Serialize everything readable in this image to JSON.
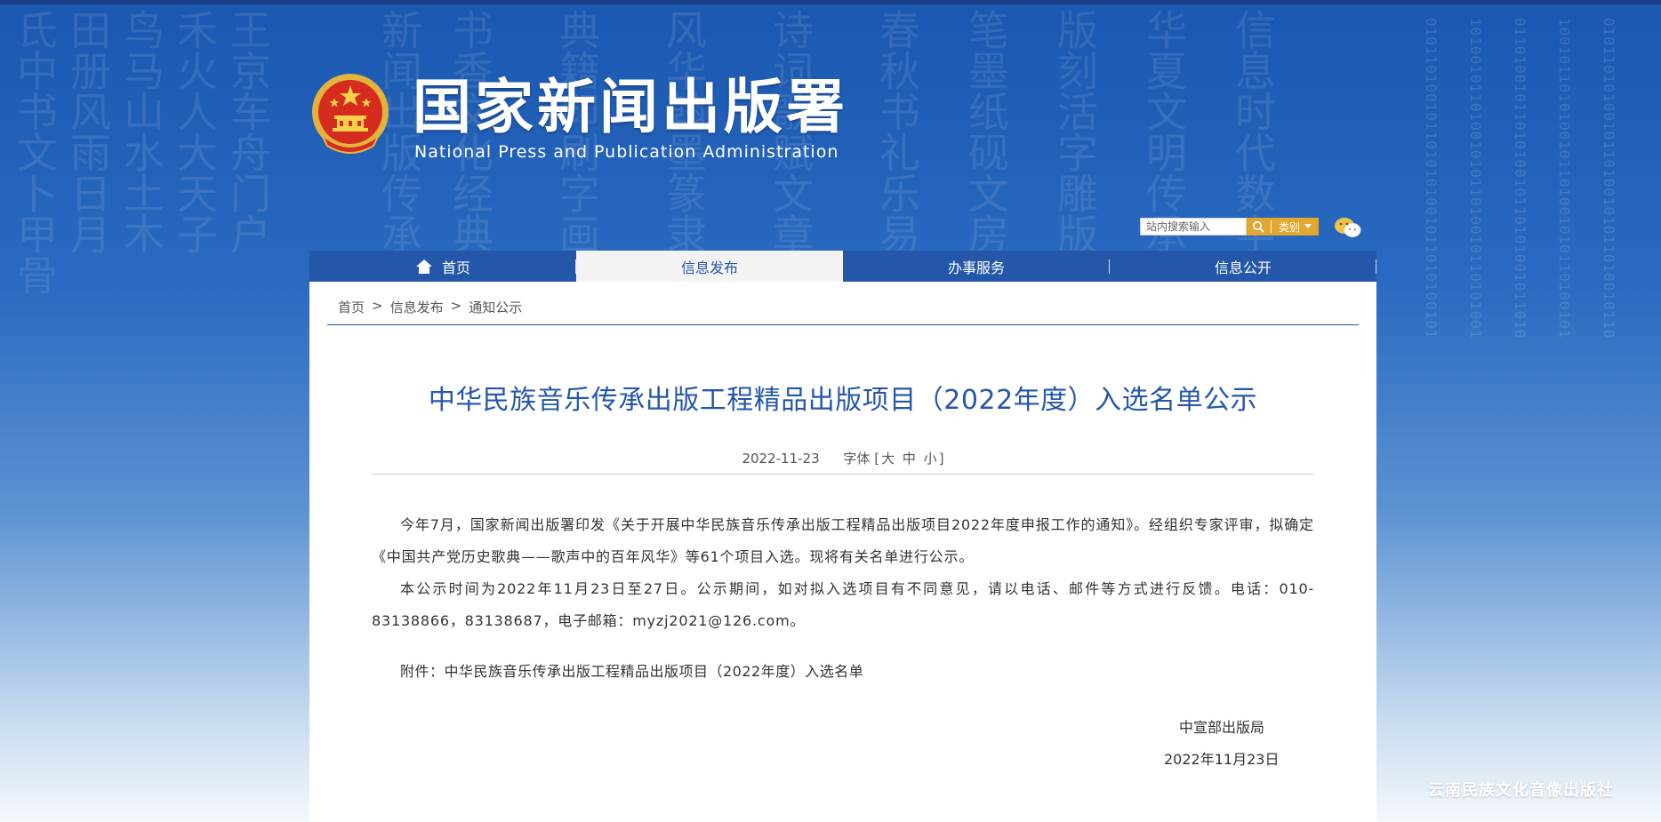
{
  "header": {
    "title_cn": "国家新闻出版署",
    "title_en": "National  Press and Publication Administration"
  },
  "search": {
    "placeholder": "站内搜索输入",
    "category_label": "类别"
  },
  "nav": {
    "items": [
      {
        "label": "首页"
      },
      {
        "label": "信息发布"
      },
      {
        "label": "办事服务"
      },
      {
        "label": "信息公开"
      }
    ]
  },
  "breadcrumb": {
    "home": "首页",
    "section": "信息发布",
    "current": "通知公示",
    "separator": ">"
  },
  "article": {
    "title": "中华民族音乐传承出版工程精品出版项目（2022年度）入选名单公示",
    "date": "2022-11-23",
    "font_size_label": "字体",
    "font_open": "[",
    "font_large": "大",
    "font_medium": "中",
    "font_small": "小",
    "font_close": "]",
    "paragraphs": [
      "今年7月，国家新闻出版署印发《关于开展中华民族音乐传承出版工程精品出版项目2022年度申报工作的通知》。经组织专家评审，拟确定《中国共产党历史歌典——歌声中的百年风华》等61个项目入选。现将有关名单进行公示。",
      "本公示时间为2022年11月23日至27日。公示期间，如对拟入选项目有不同意见，请以电话、邮件等方式进行反馈。电话：010-83138866，83138687，电子邮箱：myzj2021@126.com。"
    ],
    "attachment": "附件：中华民族音乐传承出版工程精品出版项目（2022年度）入选名单",
    "signature_org": "中宣部出版局",
    "signature_date": "2022年11月23日"
  },
  "watermark": "云南民族文化音像出版社",
  "colors": {
    "brand_blue": "#2457aa",
    "accent_gold": "#e3a62e"
  }
}
